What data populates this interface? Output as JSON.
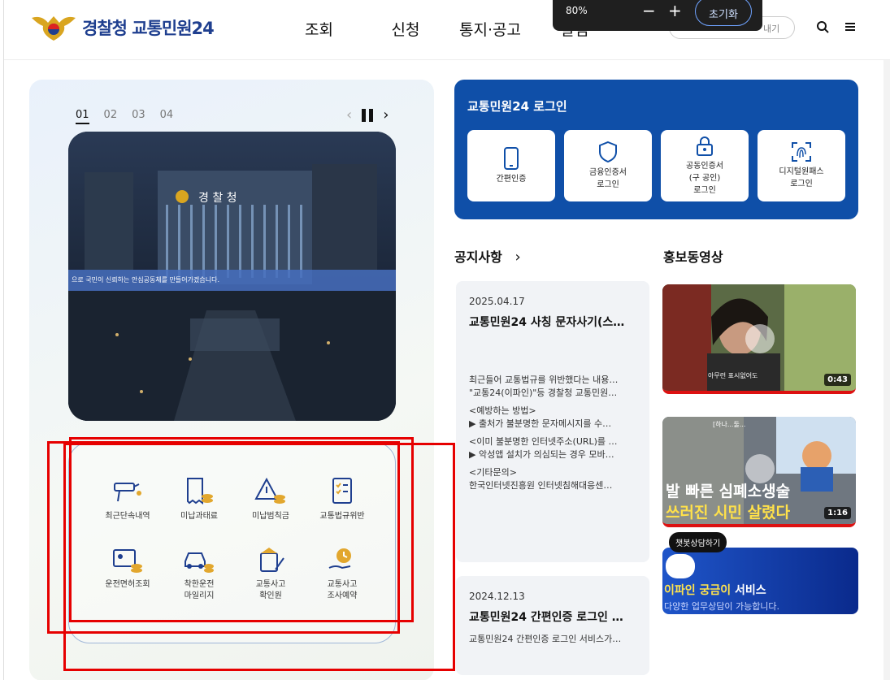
{
  "header": {
    "logo_text": "경찰청 교통민원24",
    "nav": [
      "조회",
      "신청",
      "통지·공고",
      "알림"
    ],
    "pill_text": "내기",
    "search_icon": "search-icon",
    "menu_icon": "hamburger-icon"
  },
  "zoom": {
    "level": "80%",
    "minus": "−",
    "plus": "+",
    "reset": "초기화"
  },
  "slider": {
    "pages": [
      "01",
      "02",
      "03",
      "04"
    ],
    "active": "01",
    "prev": "‹",
    "next": "›",
    "banner": "으로 국민이 신뢰하는 안심공동체를 만들어가겠습니다.",
    "building_sign": "경 찰 청"
  },
  "quick": [
    {
      "label": "최근단속내역",
      "icon": "camera-icon"
    },
    {
      "label": "미납과태료",
      "icon": "receipt-coins-icon"
    },
    {
      "label": "미납범칙금",
      "icon": "warning-coins-icon"
    },
    {
      "label": "교통법규위반",
      "icon": "checklist-icon"
    },
    {
      "label": "운전면허조회",
      "icon": "id-card-icon"
    },
    {
      "label": "착한운전\n마일리지",
      "icon": "car-coins-icon"
    },
    {
      "label": "교통사고\n확인원",
      "icon": "document-pen-icon"
    },
    {
      "label": "교통사고\n조사예약",
      "icon": "hand-clock-icon"
    }
  ],
  "login": {
    "title": "교통민원24 로그인",
    "options": [
      {
        "label": "간편인증",
        "icon": "phone-icon"
      },
      {
        "label": "금융인증서\n로그인",
        "icon": "shield-icon"
      },
      {
        "label": "공동인증서\n(구 공인)\n로그인",
        "icon": "lock-icon"
      },
      {
        "label": "디지털원패스\n로그인",
        "icon": "fingerprint-icon"
      }
    ]
  },
  "notice": {
    "title": "공지사항",
    "more": "›",
    "items": [
      {
        "date": "2025.04.17",
        "title": "교통민원24 사칭 문자사기(스…",
        "lines": [
          "최근들어 교통법규를 위반했다는 내용…",
          "\"교통24(이파인)\"등 경찰청 교통민원…",
          "<예방하는 방법>",
          "▶ 출처가 불분명한 문자메시지를 수…",
          "<이미 불분명한 인터넷주소(URL)를 …",
          "▶ 악성앱 설치가 의심되는 경우 모바…",
          "<기타문의>",
          "한국인터넷진흥원 인터넷침해대응센…"
        ]
      },
      {
        "date": "2024.12.13",
        "title": "교통민원24 간편인증 로그인 …",
        "lines": [
          "교통민원24 간편인증 로그인 서비스가…"
        ]
      }
    ]
  },
  "videos": {
    "title": "홍보동영상",
    "items": [
      {
        "duration": "0:43",
        "caption": "아무런 표시없어도"
      },
      {
        "duration": "1:16",
        "caption_top": "발 빠른 심폐소생술",
        "caption_bottom": "쓰러진 시민 살렸다",
        "tag": "[하나...둘..."
      }
    ]
  },
  "chatbot": {
    "bubble": "챗봇상담하기",
    "title_hl": "이파인 궁금이",
    "title_rest": " 서비스",
    "sub": "다양한 업무상담이 가능합니다."
  }
}
